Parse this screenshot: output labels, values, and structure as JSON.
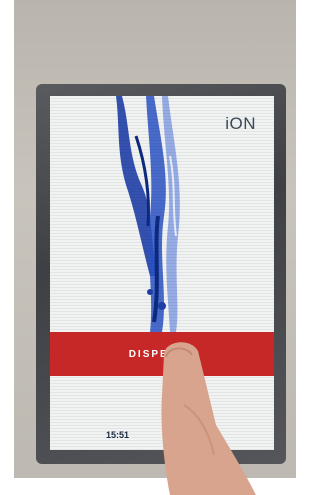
{
  "brand": {
    "logo_text": "iON"
  },
  "dispense_button": {
    "label": "DISPENSE"
  },
  "status_bar": {
    "time": "15:51"
  },
  "colors": {
    "accent_red": "#c62828",
    "water_blue": "#1f3fa8",
    "screen_bg": "#f1f2f2"
  }
}
